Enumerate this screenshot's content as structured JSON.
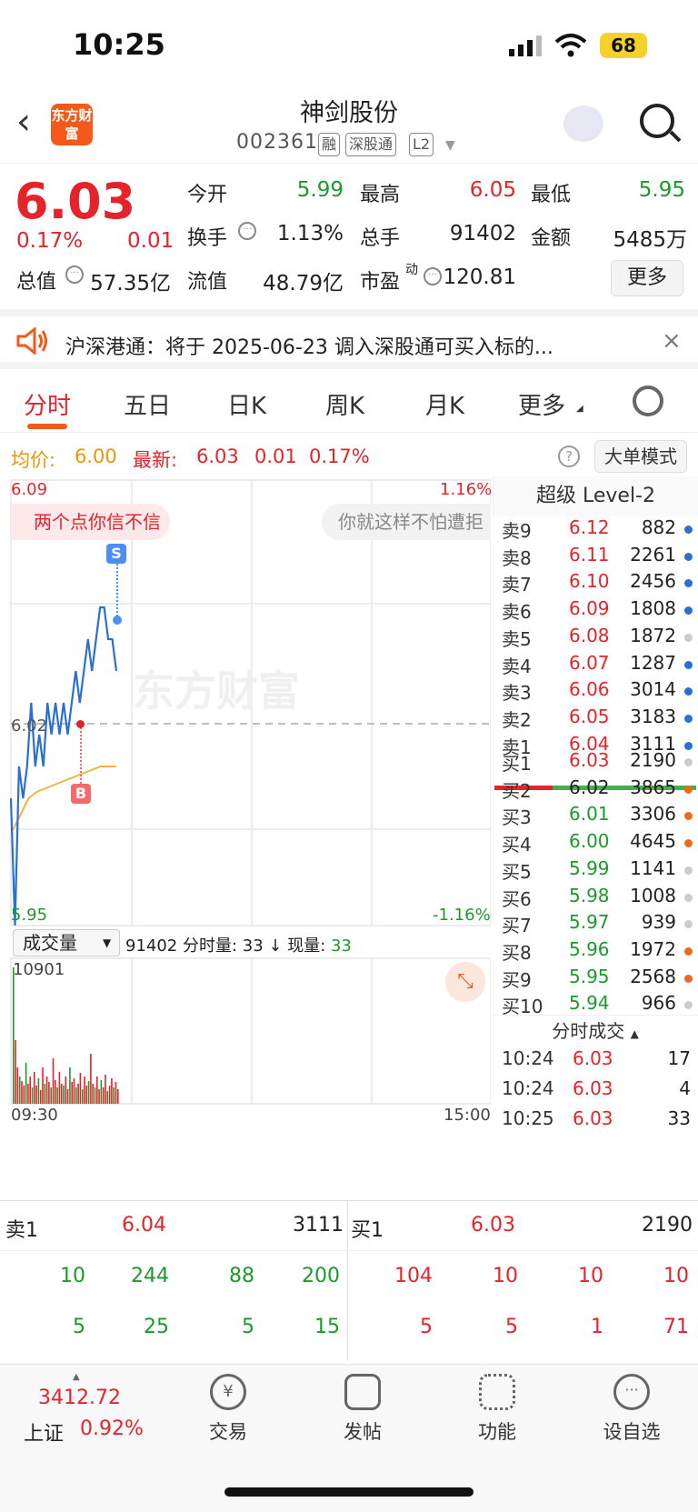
{
  "status_bar": {
    "time": "10:25",
    "battery": "68"
  },
  "header": {
    "stock_name": "神剑股份",
    "stock_code": "002361",
    "tags": [
      "融",
      "深股通",
      "L2"
    ],
    "logo_text": "东方财富"
  },
  "quote": {
    "price": "6.03",
    "change_pct": "0.17%",
    "change": "0.01",
    "open_label": "今开",
    "open": "5.99",
    "high_label": "最高",
    "high": "6.05",
    "low_label": "最低",
    "low": "5.95",
    "turnover_label": "换手",
    "turnover": "1.13%",
    "volume_label": "总手",
    "volume": "91402",
    "amount_label": "金额",
    "amount": "5485万",
    "mktcap_label": "总值",
    "mktcap": "57.35亿",
    "float_label": "流值",
    "float": "48.79亿",
    "pe_label": "市盈",
    "pe_sup": "动",
    "pe": "120.81",
    "more": "更多"
  },
  "notice": {
    "text": "沪深港通：将于 2025-06-23 调入深股通可买入标的..."
  },
  "tabs": [
    "分时",
    "五日",
    "日K",
    "周K",
    "月K",
    "更多"
  ],
  "infobar": {
    "avg_label": "均价:",
    "avg": "6.00",
    "last_label": "最新:",
    "last": "6.03",
    "chg": "0.01",
    "pct": "0.17%",
    "mode_button": "大单模式"
  },
  "chart": {
    "top_price": "6.09",
    "top_pct": "1.16%",
    "bottom_price": "5.95",
    "bottom_pct": "-1.16%",
    "ref_price": "6.02",
    "bubble_left": "两个点你信不信",
    "bubble_right": "你就这样不怕遭拒",
    "watermark": "东方财富",
    "sell_marker": "S",
    "buy_marker": "B",
    "vol_selector": "成交量",
    "vol_info": "91402 分时量: 33 ↓ 现量: ",
    "vol_now": "33",
    "vol_max": "10901",
    "time_start": "09:30",
    "time_end": "15:00"
  },
  "chart_data": {
    "type": "line",
    "series": [
      {
        "values": [
          5.99,
          5.95,
          6.0,
          5.99,
          6.0,
          6.02,
          6.0,
          6.01,
          6.0,
          6.02,
          6.01,
          6.02,
          6.01,
          6.02,
          6.01,
          6.02,
          6.03,
          6.02,
          6.03,
          6.04,
          6.03,
          6.04,
          6.05,
          6.05,
          6.04,
          6.04,
          6.03
        ]
      },
      {
        "values": [
          5.98,
          5.985,
          5.99,
          5.992,
          5.993,
          5.994,
          5.995,
          5.996,
          5.997,
          5.998,
          5.999,
          6.0,
          6.0,
          6.0
        ]
      }
    ],
    "ylim": [
      5.95,
      6.09
    ]
  },
  "orderbook": {
    "title": "超级 Level-2",
    "asks": [
      {
        "label": "卖9",
        "price": "6.12",
        "vol": "882"
      },
      {
        "label": "卖8",
        "price": "6.11",
        "vol": "2261"
      },
      {
        "label": "卖7",
        "price": "6.10",
        "vol": "2456"
      },
      {
        "label": "卖6",
        "price": "6.09",
        "vol": "1808"
      },
      {
        "label": "卖5",
        "price": "6.08",
        "vol": "1872"
      },
      {
        "label": "卖4",
        "price": "6.07",
        "vol": "1287"
      },
      {
        "label": "卖3",
        "price": "6.06",
        "vol": "3014"
      },
      {
        "label": "卖2",
        "price": "6.05",
        "vol": "3183"
      },
      {
        "label": "卖1",
        "price": "6.04",
        "vol": "3111"
      }
    ],
    "bids": [
      {
        "label": "买1",
        "price": "6.03",
        "vol": "2190"
      },
      {
        "label": "买2",
        "price": "6.02",
        "vol": "3865"
      },
      {
        "label": "买3",
        "price": "6.01",
        "vol": "3306"
      },
      {
        "label": "买4",
        "price": "6.00",
        "vol": "4645"
      },
      {
        "label": "买5",
        "price": "5.99",
        "vol": "1141"
      },
      {
        "label": "买6",
        "price": "5.98",
        "vol": "1008"
      },
      {
        "label": "买7",
        "price": "5.97",
        "vol": "939"
      },
      {
        "label": "买8",
        "price": "5.96",
        "vol": "1972"
      },
      {
        "label": "买9",
        "price": "5.95",
        "vol": "2568"
      },
      {
        "label": "买10",
        "price": "5.94",
        "vol": "966"
      }
    ],
    "ticks_title": "分时成交",
    "ticks": [
      {
        "time": "10:24",
        "price": "6.03",
        "vol": "17"
      },
      {
        "time": "10:24",
        "price": "6.03",
        "vol": "4"
      },
      {
        "time": "10:25",
        "price": "6.03",
        "vol": "33"
      }
    ]
  },
  "bottom_book": {
    "sell_label": "卖1",
    "sell_price": "6.04",
    "sell_vol": "3111",
    "buy_label": "买1",
    "buy_price": "6.03",
    "buy_vol": "2190",
    "sell_row1": [
      "10",
      "244",
      "88",
      "200"
    ],
    "buy_row1": [
      "104",
      "10",
      "10",
      "10"
    ],
    "sell_row2": [
      "5",
      "25",
      "5",
      "15"
    ],
    "buy_row2": [
      "5",
      "5",
      "1",
      "71"
    ]
  },
  "nav": {
    "index_value": "3412.72",
    "index_name": "上证",
    "index_pct": "0.92%",
    "items": [
      "交易",
      "发帖",
      "功能",
      "设自选"
    ]
  }
}
